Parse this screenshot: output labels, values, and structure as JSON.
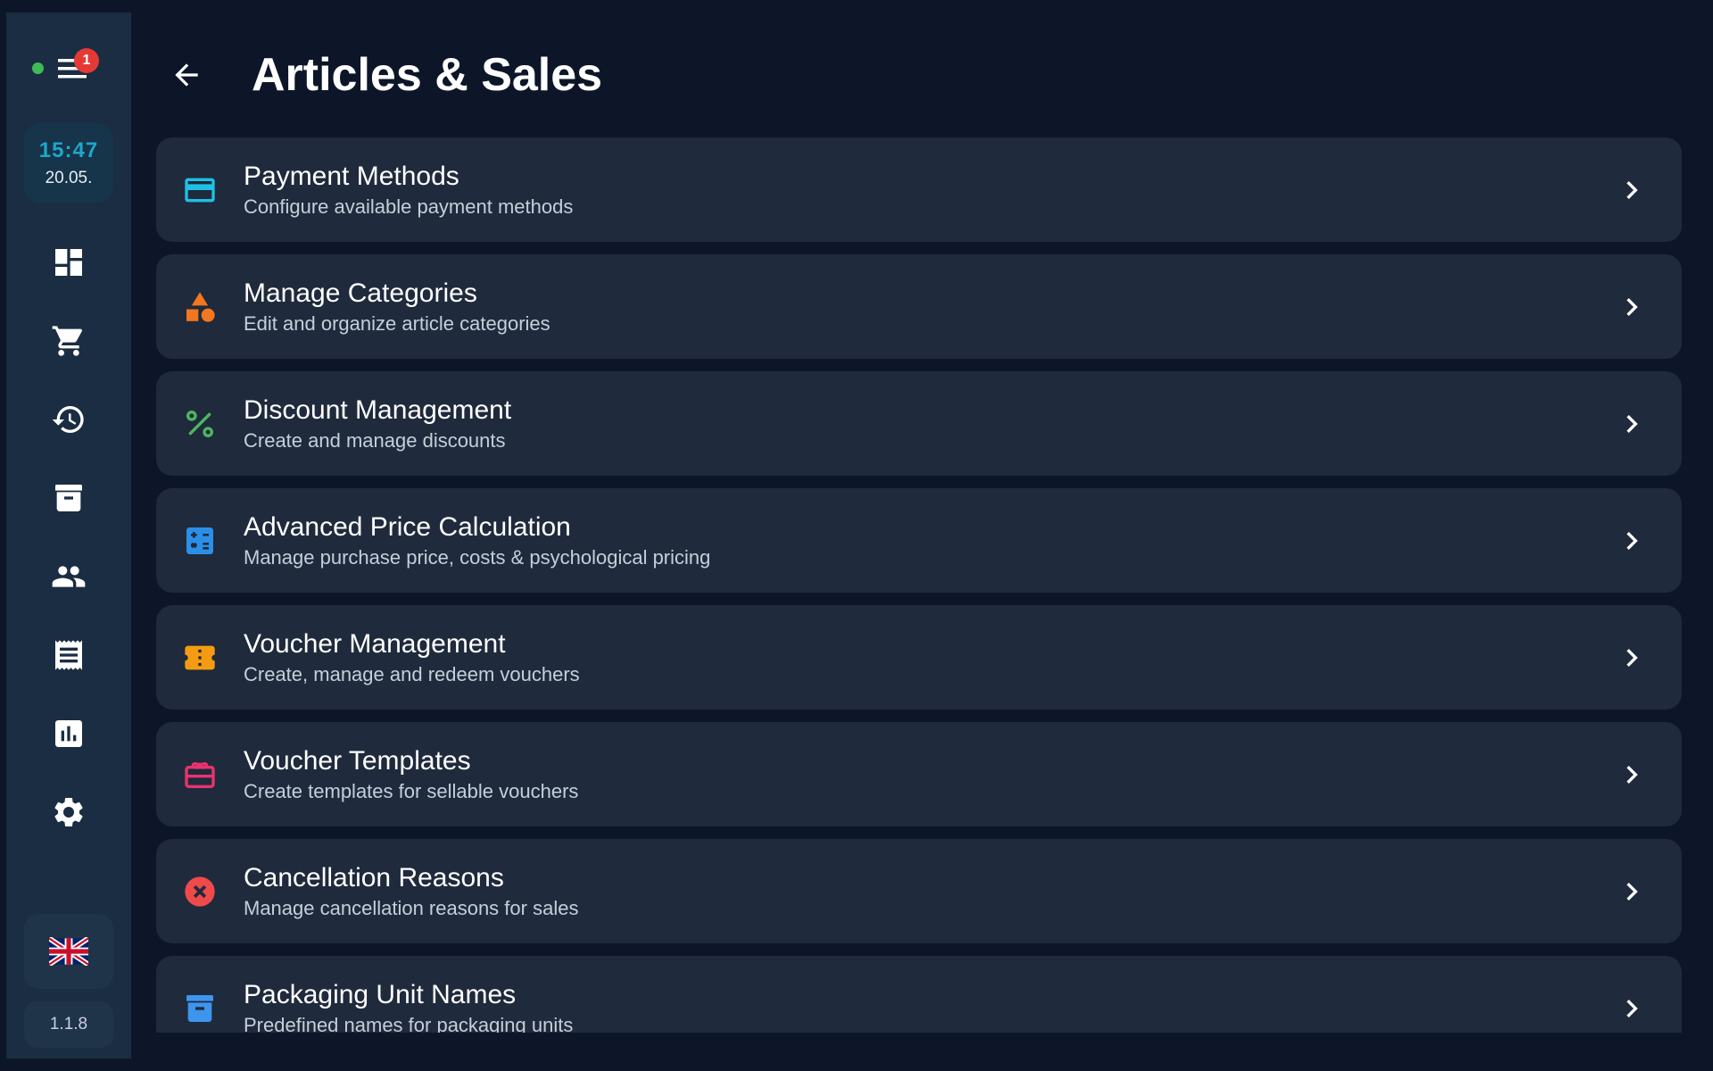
{
  "header": {
    "title": "Articles & Sales"
  },
  "sidebar": {
    "notification_count": "1",
    "clock_time": "15:47",
    "clock_date": "20.05.",
    "version": "1.1.8"
  },
  "colors": {
    "payment": "#1ec1e6",
    "categories": "#f2771e",
    "discount": "#4cb860",
    "price": "#2b8fe8",
    "voucher": "#f59b12",
    "templates": "#e8336f",
    "cancellation": "#ef4a4a",
    "packaging": "#3d95ee"
  },
  "settings": [
    {
      "title": "Payment Methods",
      "subtitle": "Configure available payment methods",
      "icon": "credit-card-icon"
    },
    {
      "title": "Manage Categories",
      "subtitle": "Edit and organize article categories",
      "icon": "shapes-icon"
    },
    {
      "title": "Discount Management",
      "subtitle": "Create and manage discounts",
      "icon": "percent-icon"
    },
    {
      "title": "Advanced Price Calculation",
      "subtitle": "Manage purchase price, costs & psychological pricing",
      "icon": "calculator-icon"
    },
    {
      "title": "Voucher Management",
      "subtitle": "Create, manage and redeem vouchers",
      "icon": "ticket-icon"
    },
    {
      "title": "Voucher Templates",
      "subtitle": "Create templates for sellable vouchers",
      "icon": "gift-card-icon"
    },
    {
      "title": "Cancellation Reasons",
      "subtitle": "Manage cancellation reasons for sales",
      "icon": "cancel-icon"
    },
    {
      "title": "Packaging Unit Names",
      "subtitle": "Predefined names for packaging units",
      "icon": "archive-box-icon"
    }
  ]
}
